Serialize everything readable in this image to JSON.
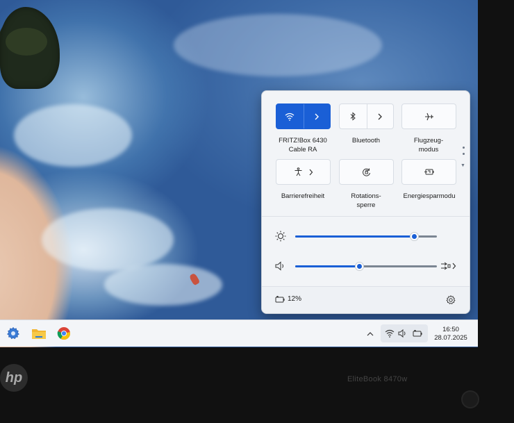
{
  "quick_settings": {
    "tiles": [
      {
        "id": "wifi",
        "label": "FRITZ!Box 6430 Cable RA",
        "active": true,
        "icon": "wifi-icon"
      },
      {
        "id": "bluetooth",
        "label": "Bluetooth",
        "active": false,
        "icon": "bluetooth-icon"
      },
      {
        "id": "airplane",
        "label": "Flugzeug-modus",
        "active": false,
        "icon": "airplane-icon"
      },
      {
        "id": "accessibility",
        "label": "Barrierefreiheit",
        "active": false,
        "icon": "accessibility-icon"
      },
      {
        "id": "rotation",
        "label": "Rotations-sperre",
        "active": false,
        "icon": "rotation-lock-icon"
      },
      {
        "id": "energy",
        "label": "Energiesparmodu",
        "active": false,
        "icon": "battery-saver-icon"
      }
    ],
    "wifi_label_line1": "FRITZ!Box 6430",
    "wifi_label_line2": "Cable RA",
    "bluetooth_label": "Bluetooth",
    "airplane_label_line1": "Flugzeug-",
    "airplane_label_line2": "modus",
    "accessibility_label": "Barrierefreiheit",
    "rotation_label_line1": "Rotations-",
    "rotation_label_line2": "sperre",
    "energy_label": "Energiesparmodu",
    "brightness_level": 0.84,
    "volume_level": 0.45,
    "battery_text": "12%",
    "accent_color": "#1a5fd6"
  },
  "taskbar": {
    "pinned_icons": [
      "settings-icon",
      "file-explorer-icon",
      "chrome-icon"
    ],
    "tray_icons": [
      "chevron-up-icon",
      "wifi-icon",
      "volume-icon",
      "battery-icon"
    ],
    "time": "16:50",
    "date": "28.07.2025"
  },
  "device": {
    "logo": "hp",
    "model": "EliteBook 8470w"
  }
}
